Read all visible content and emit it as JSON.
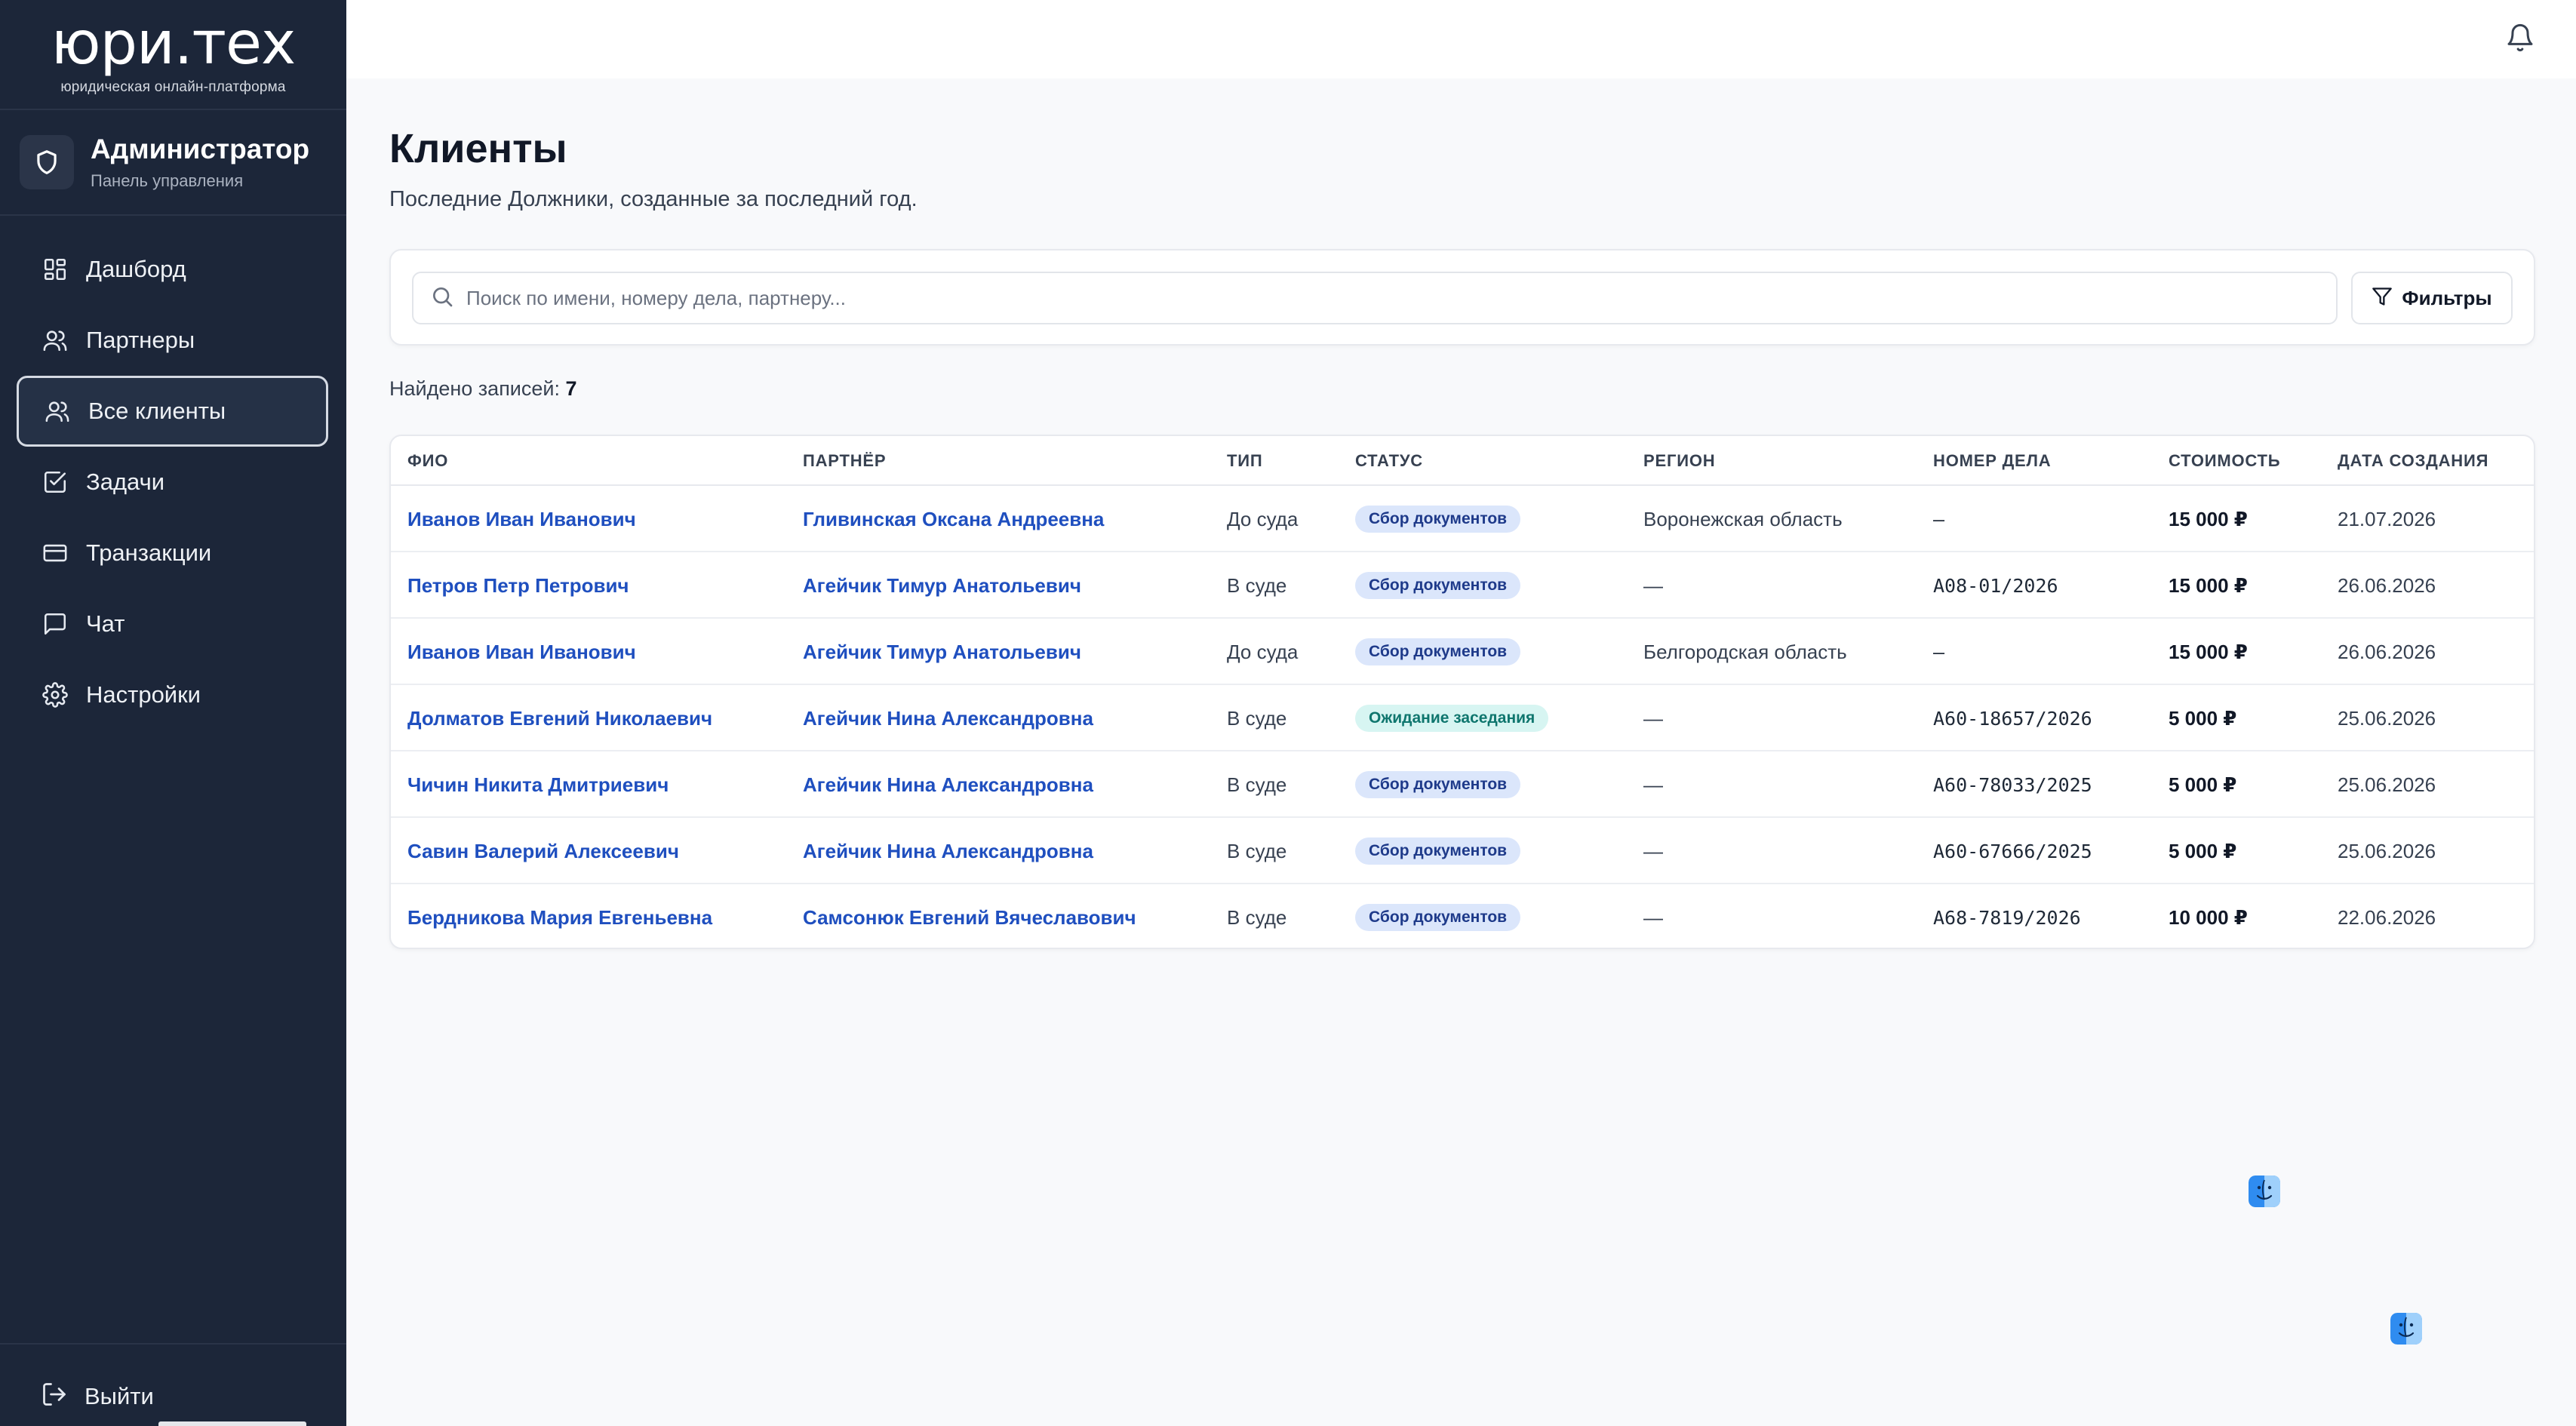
{
  "brand": {
    "logo": "юри.тех",
    "tagline": "юридическая онлайн-платформа"
  },
  "role": {
    "title": "Администратор",
    "subtitle": "Панель управления"
  },
  "nav": [
    {
      "label": "Дашборд",
      "icon": "dashboard-icon"
    },
    {
      "label": "Партнеры",
      "icon": "users-icon"
    },
    {
      "label": "Все клиенты",
      "icon": "users-icon",
      "active": true
    },
    {
      "label": "Задачи",
      "icon": "checkbox-icon"
    },
    {
      "label": "Транзакции",
      "icon": "credit-card-icon"
    },
    {
      "label": "Чат",
      "icon": "message-icon"
    },
    {
      "label": "Настройки",
      "icon": "gear-icon"
    }
  ],
  "logout_label": "Выйти",
  "page": {
    "title": "Клиенты",
    "subtitle": "Последние Должники, созданные за последний год."
  },
  "search": {
    "placeholder": "Поиск по имени, номеру дела, партнеру...",
    "value": ""
  },
  "filters_label": "Фильтры",
  "found": {
    "label": "Найдено записей:",
    "count": "7"
  },
  "table": {
    "headers": [
      "ФИО",
      "ПАРТНЁР",
      "ТИП",
      "СТАТУС",
      "РЕГИОН",
      "НОМЕР ДЕЛА",
      "СТОИМОСТЬ",
      "ДАТА СОЗДАНИЯ"
    ],
    "rows": [
      {
        "name": "Иванов Иван Иванович",
        "partner": "Гливинская Оксана Андреевна",
        "type": "До суда",
        "status": "Сбор документов",
        "status_kind": "docs",
        "region": "Воронежская область",
        "case": "—",
        "cost": "15 000 ₽",
        "date": "21.07.2026"
      },
      {
        "name": "Петров Петр Петрович",
        "partner": "Агейчик Тимур Анатольевич",
        "type": "В суде",
        "status": "Сбор документов",
        "status_kind": "docs",
        "region": "—",
        "case": "А08-01/2026",
        "cost": "15 000 ₽",
        "date": "26.06.2026"
      },
      {
        "name": "Иванов Иван Иванович",
        "partner": "Агейчик Тимур Анатольевич",
        "type": "До суда",
        "status": "Сбор документов",
        "status_kind": "docs",
        "region": "Белгородская область",
        "case": "—",
        "cost": "15 000 ₽",
        "date": "26.06.2026"
      },
      {
        "name": "Долматов Евгений Николаевич",
        "partner": "Агейчик Нина Александровна",
        "type": "В суде",
        "status": "Ожидание заседания",
        "status_kind": "wait",
        "region": "—",
        "case": "А60-18657/2026",
        "cost": "5 000 ₽",
        "date": "25.06.2026"
      },
      {
        "name": "Чичин Никита Дмитриевич",
        "partner": "Агейчик Нина Александровна",
        "type": "В суде",
        "status": "Сбор документов",
        "status_kind": "docs",
        "region": "—",
        "case": "А60-78033/2025",
        "cost": "5 000 ₽",
        "date": "25.06.2026"
      },
      {
        "name": "Савин Валерий Алексеевич",
        "partner": "Агейчик Нина Александровна",
        "type": "В суде",
        "status": "Сбор документов",
        "status_kind": "docs",
        "region": "—",
        "case": "А60-67666/2025",
        "cost": "5 000 ₽",
        "date": "25.06.2026"
      },
      {
        "name": "Бердникова Мария Евгеньевна",
        "partner": "Самсонюк Евгений Вячеславович",
        "type": "В суде",
        "status": "Сбор документов",
        "status_kind": "docs",
        "region": "—",
        "case": "А68-7819/2026",
        "cost": "10 000 ₽",
        "date": "22.06.2026"
      }
    ]
  },
  "colors": {
    "sidebar": "#1c2639",
    "link": "#1f4fbf",
    "badge_docs": "#dbe6fb",
    "badge_wait": "#d7f5f2"
  }
}
